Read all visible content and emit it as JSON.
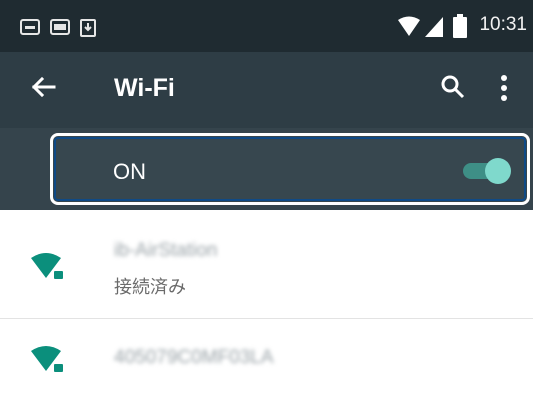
{
  "status_bar": {
    "time": "10:31",
    "icons": [
      "notification-icon",
      "gallery-icon",
      "download-icon",
      "wifi-signal-icon",
      "cell-signal-icon",
      "battery-icon"
    ]
  },
  "toolbar": {
    "title": "Wi-Fi",
    "back_icon": "arrow-back-icon",
    "search_icon": "search-icon",
    "more_icon": "more-vert-icon"
  },
  "wifi_toggle": {
    "label": "ON",
    "state": true
  },
  "networks": [
    {
      "name": "ib-AirStation",
      "status": "接続済み",
      "secured": true
    },
    {
      "name": "405079C0MF03LA",
      "status": "",
      "secured": true
    }
  ],
  "colors": {
    "status_bar": "#1f2b31",
    "toolbar": "#2e3d45",
    "toggle_band": "#35444c",
    "accent": "#7fd9cc",
    "wifi_icon": "#0b8f7c",
    "highlight_border": "#0f4a86"
  }
}
